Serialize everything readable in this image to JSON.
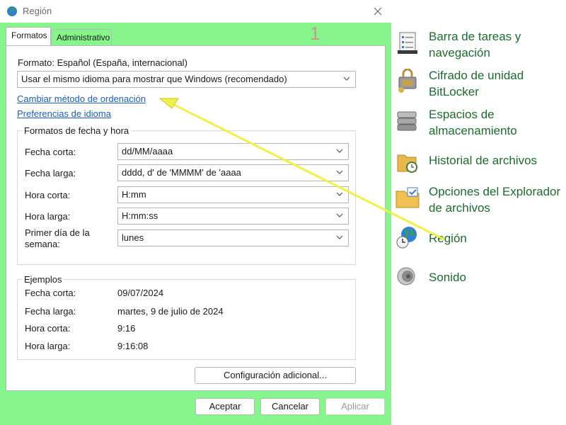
{
  "dialog": {
    "title": "Región",
    "tabs": [
      {
        "label": "Formatos"
      },
      {
        "label": "Administrativo"
      }
    ],
    "step_marker": "1",
    "format_label": "Formato: Español (España, internacional)",
    "format_select": "Usar el mismo idioma para mostrar que Windows (recomendado)",
    "links": {
      "sort": "Cambiar método de ordenación",
      "language": "Preferencias de idioma"
    },
    "datetime": {
      "title": "Formatos de fecha y hora",
      "rows": [
        {
          "label": "Fecha corta:",
          "value": "dd/MM/aaaa"
        },
        {
          "label": "Fecha larga:",
          "value": "dddd, d' de 'MMMM' de 'aaaa"
        },
        {
          "label": "Hora corta:",
          "value": "H:mm"
        },
        {
          "label": "Hora larga:",
          "value": "H:mm:ss"
        },
        {
          "label": "Primer día de la semana:",
          "value": "lunes"
        }
      ]
    },
    "examples": {
      "title": "Ejemplos",
      "rows": [
        {
          "label": "Fecha corta:",
          "value": "09/07/2024"
        },
        {
          "label": "Fecha larga:",
          "value": "martes, 9 de julio de 2024"
        },
        {
          "label": "Hora corta:",
          "value": "9:16"
        },
        {
          "label": "Hora larga:",
          "value": "9:16:08"
        }
      ]
    },
    "buttons": {
      "additional": "Configuración adicional...",
      "accept": "Aceptar",
      "cancel": "Cancelar",
      "apply": "Aplicar"
    }
  },
  "control_panel": {
    "items": [
      {
        "label_line1": "Barra de tareas y",
        "label_line2": "navegación",
        "icon": "taskbar-icon"
      },
      {
        "label_line1": "Cifrado de unidad",
        "label_line2": "BitLocker",
        "icon": "bitlocker-icon"
      },
      {
        "label_line1": "Espacios de",
        "label_line2": "almacenamiento",
        "icon": "storage-spaces-icon"
      },
      {
        "label_line1": "Historial de archivos",
        "label_line2": "",
        "icon": "file-history-icon"
      },
      {
        "label_line1": "Opciones del Explorador",
        "label_line2": "de archivos",
        "icon": "explorer-options-icon"
      },
      {
        "label_line1": "Región",
        "label_line2": "",
        "icon": "region-icon"
      },
      {
        "label_line1": "Sonido",
        "label_line2": "",
        "icon": "sound-icon"
      }
    ]
  },
  "colors": {
    "highlight_green": "#86f58b",
    "annotation_arrow": "#f0f04a",
    "link_blue": "#1a5fb4",
    "panel_text_green": "#1d6b2f"
  }
}
